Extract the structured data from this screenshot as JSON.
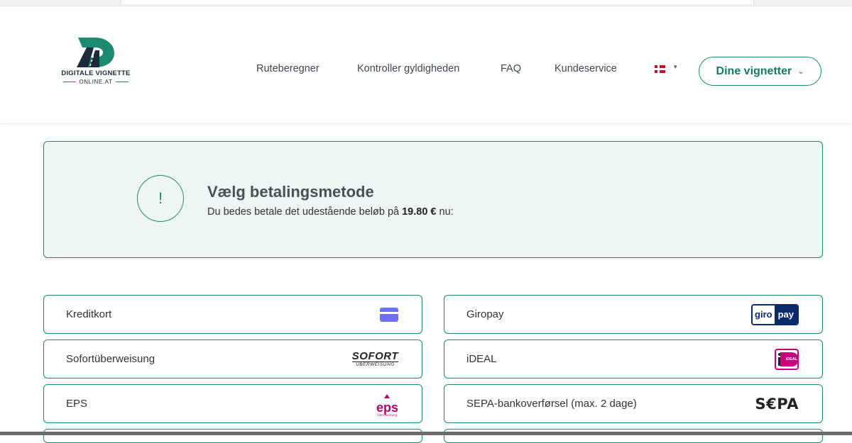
{
  "brand": {
    "name": "DIGITALE VIGNETTE",
    "sub": "ONLINE.AT",
    "accent": "#1c8a6f"
  },
  "nav": {
    "links": [
      "Ruteberegner",
      "Kontroller gyldigheden",
      "FAQ",
      "Kundeservice"
    ],
    "language": "Danish flag",
    "account_button": "Dine vignetter"
  },
  "notice": {
    "icon": "!",
    "title": "Vælg betalingsmetode",
    "text_before": "Du bedes betale det udestående beløb på",
    "amount": "19.80 €",
    "text_after": "nu:"
  },
  "payment_methods": [
    {
      "label": "Kreditkort",
      "logo": "credit-card-icon"
    },
    {
      "label": "Giropay",
      "logo": "giropay-logo",
      "logo_text": [
        "giro",
        "pay"
      ]
    },
    {
      "label": "Sofortüberweisung",
      "logo": "sofort-logo",
      "logo_text": [
        "SOFORT",
        "ÜBERWEISUNG"
      ]
    },
    {
      "label": "iDEAL",
      "logo": "ideal-logo",
      "logo_text": "iDEAL"
    },
    {
      "label": "EPS",
      "logo": "eps-logo",
      "logo_text": [
        "eps",
        "Überweisung"
      ]
    },
    {
      "label": "SEPA-bankoverførsel (max. 2 dage)",
      "logo": "sepa-logo",
      "logo_text": "S€PA"
    }
  ]
}
